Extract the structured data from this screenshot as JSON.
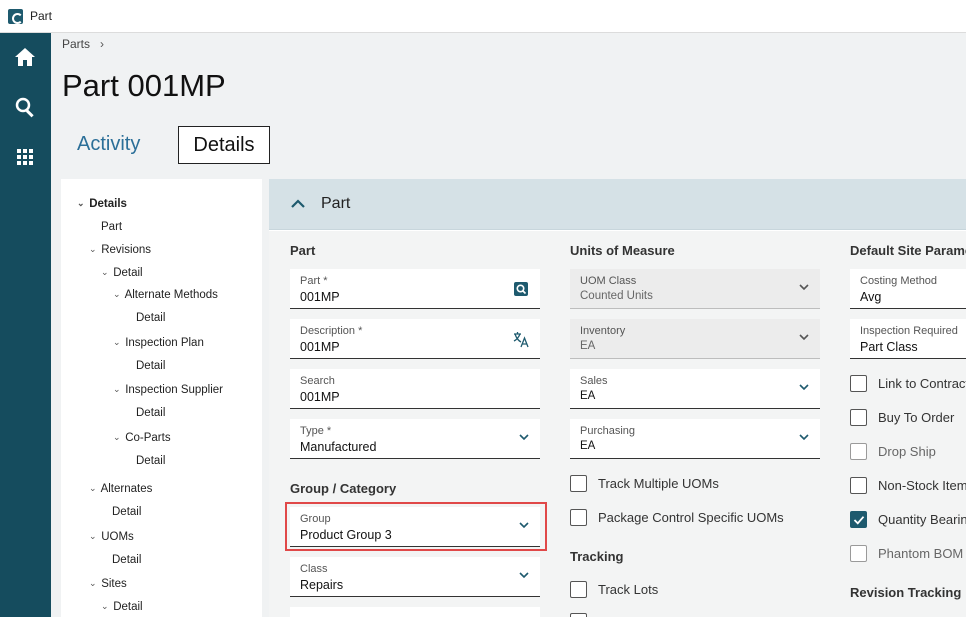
{
  "app": {
    "title": "Part"
  },
  "rail": {
    "icons": [
      "home-icon",
      "search-icon",
      "apps-grid-icon"
    ]
  },
  "breadcrumb": {
    "item": "Parts",
    "separator": "›"
  },
  "page": {
    "title": "Part 001MP"
  },
  "tabs": [
    {
      "label": "Activity",
      "active": false
    },
    {
      "label": "Details",
      "active": true
    }
  ],
  "tree": {
    "items": [
      "Details",
      "Part",
      "Revisions",
      "Detail",
      "Alternate Methods",
      "Detail",
      "Inspection Plan",
      "Detail",
      "Inspection Supplier",
      "Detail",
      "Co-Parts",
      "Detail",
      "Alternates",
      "Detail",
      "UOMs",
      "Detail",
      "Sites",
      "Detail"
    ]
  },
  "panel": {
    "title": "Part",
    "part_section": {
      "title": "Part",
      "part": {
        "label": "Part *",
        "value": "001MP"
      },
      "description": {
        "label": "Description *",
        "value": "001MP"
      },
      "search": {
        "label": "Search",
        "value": "001MP"
      },
      "type": {
        "label": "Type *",
        "value": "Manufactured"
      }
    },
    "group_section": {
      "title": "Group / Category",
      "group": {
        "label": "Group",
        "value": "Product Group 3"
      },
      "class": {
        "label": "Class",
        "value": "Repairs"
      }
    },
    "uom_section": {
      "title": "Units of Measure",
      "uom_class": {
        "label": "UOM Class",
        "value": "Counted Units"
      },
      "inventory": {
        "label": "Inventory",
        "value": "EA"
      },
      "sales": {
        "label": "Sales",
        "value": "EA"
      },
      "purchasing": {
        "label": "Purchasing",
        "value": "EA"
      },
      "track_multiple": {
        "label": "Track Multiple UOMs",
        "checked": false
      },
      "package_control": {
        "label": "Package Control Specific UOMs",
        "checked": false
      }
    },
    "tracking_section": {
      "title": "Tracking",
      "track_lots": {
        "label": "Track Lots",
        "checked": false
      }
    },
    "site_section": {
      "title": "Default Site Paramet",
      "costing": {
        "label": "Costing Method",
        "value": "Avg"
      },
      "inspection": {
        "label": "Inspection Required",
        "value": "Part Class"
      },
      "link_contract": {
        "label": "Link to Contract",
        "checked": false
      },
      "buy_to_order": {
        "label": "Buy To Order",
        "checked": false
      },
      "drop_ship": {
        "label": "Drop Ship",
        "checked": false
      },
      "non_stock": {
        "label": "Non-Stock Item",
        "checked": false
      },
      "quantity_bearing": {
        "label": "Quantity Bearing",
        "checked": true
      },
      "phantom_bom": {
        "label": "Phantom BOM",
        "checked": false
      }
    },
    "revision_section": {
      "title": "Revision Tracking"
    }
  },
  "colors": {
    "rail": "#154c5e",
    "accent": "#1e5a6e",
    "tab_link": "#2b6f98",
    "highlight": "#e04848"
  }
}
